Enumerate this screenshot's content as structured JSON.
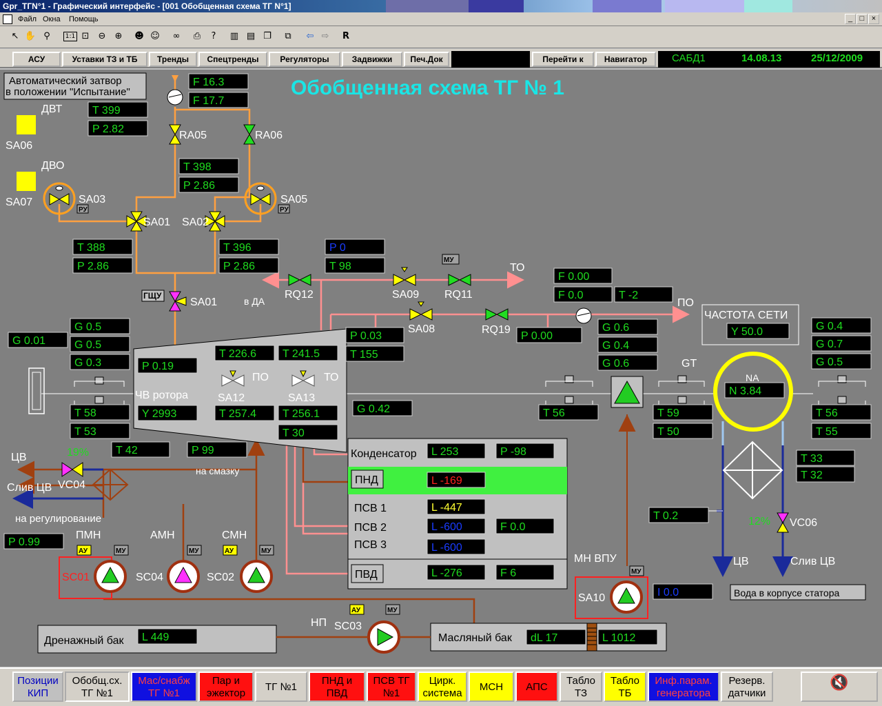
{
  "window": {
    "title": "Gpr_TГN°1 - Графический интерфейс - [001 Обобщенная схема ТГ N°1]",
    "menu": [
      "Файл",
      "Окна",
      "Помощь"
    ],
    "controls": [
      "_",
      "□",
      "×"
    ]
  },
  "toolbar": {
    "r_label": "R"
  },
  "nav": {
    "buttons": [
      "АСУ",
      "Уставки ТЗ и ТБ",
      "Тренды",
      "Спецтренды",
      "Регуляторы",
      "Задвижки",
      "Печ.Док"
    ],
    "goto": "Перейти к",
    "navigator": "Навигатор",
    "sabd": "САБД1",
    "time": "14.08.13",
    "date": "25/12/2009"
  },
  "scheme": {
    "title": "Обобщенная схема ТГ  № 1",
    "shutter_notice_line1": "Автоматический затвор",
    "shutter_notice_line2": "в положении \"Испытание\"",
    "dvt": "ДВТ",
    "dvo": "ДВО",
    "sa06": "SA06",
    "sa07": "SA07",
    "valves": {
      "ra05": "RA05",
      "ra06": "RA06",
      "sa03": "SA03",
      "sa05": "SA05",
      "sa01": "SA01",
      "sa02": "SA02",
      "sa01b": "SA01",
      "rq12": "RQ12",
      "sa09": "SA09",
      "rq11": "RQ11",
      "sa08": "SA08",
      "rq19": "RQ19",
      "sa12": "SA12",
      "sa13": "SA13",
      "vc04": "VC04",
      "vc06": "VC06"
    },
    "tags": {
      "ru": "РУ",
      "gshu": "ГЩУ",
      "mu": "МУ",
      "au": "АУ"
    },
    "labels": {
      "to": "ТО",
      "po": "ПО",
      "v_da": "в ДА",
      "po_small": "ПО",
      "to_small": "ТО",
      "chv_rotora": "ЧВ ротора",
      "gt": "GT",
      "na": "NA",
      "cv": "ЦВ",
      "sliv_cv": "Слив ЦВ",
      "na_regulirovanie": "на регулирование",
      "na_smazku": "на смазку",
      "pmn": "ПМН",
      "amn": "АМН",
      "smn": "СМН",
      "sc01": "SC01",
      "sc04": "SC04",
      "sc02": "SC02",
      "np": "НП",
      "sc03": "SC03",
      "mn_vpu": "МН ВПУ",
      "sa10": "SA10",
      "cv2": "ЦВ",
      "sliv_cv2": "Слив ЦВ",
      "voda": "Вода в корпусе статора",
      "drain": "Дренажный бак",
      "oil": "Масляный бак",
      "chastota": "ЧАСТОТА СЕТИ",
      "vc04_pct": "19%",
      "vc06_pct": "12%"
    },
    "readings": {
      "f1": "F  16.3",
      "f2": "F  17.7",
      "t399": "T  399",
      "p282": "P  2.82",
      "t398": "T  398",
      "p286a": "P  2.86",
      "t388": "T  388",
      "p286b": "P  2.86",
      "t396": "T  396",
      "p286c": "P  2.86",
      "p0": "P  0",
      "t98": "T  98",
      "f000": "F  0.00",
      "f00": "F  0.0",
      "tm2": "T  -2",
      "p003": "P  0.03",
      "t155": "T  155",
      "p000": "P  0.00",
      "g001": "G  0.01",
      "g05a": "G  0.5",
      "g05b": "G  0.5",
      "g03": "G  0.3",
      "p019": "P  0.19",
      "y2993": "Y  2993",
      "t2266": "T  226.6",
      "t2415": "T  241.5",
      "t2574": "T  257.4",
      "t2561": "T  256.1",
      "t30": "T  30",
      "t58": "T  58",
      "t53": "T  53",
      "g042": "G  0.42",
      "t56a": "T  56",
      "g06a": "G  0.6",
      "g04a": "G  0.4",
      "g06b": "G  0.6",
      "t59": "T  59",
      "t50": "T  50",
      "y500": "Y  50.0",
      "n384": "N  3.84",
      "g04b": "G  0.4",
      "g07": "G  0.7",
      "g05c": "G  0.5",
      "t56b": "T  56",
      "t55": "T  55",
      "t33": "T  33",
      "t32": "T  32",
      "t02": "T  0.2",
      "t42": "T  42",
      "p99": "P  99",
      "p099": "P  0.99",
      "l449": "L  449",
      "dl17": "dL  17",
      "l1012": "L  1012",
      "i00": "I  0.0"
    },
    "condenser": {
      "kondensator": "Конденсатор",
      "l253": "L  253",
      "pm98": "P  -98",
      "pnd": "ПНД",
      "lm169": "L  -169",
      "psv1": "ПСВ 1",
      "lm447": "L  -447",
      "psv2": "ПСВ 2",
      "lm600a": "L  -600",
      "f00": "F  0.0",
      "psv3": "ПСВ 3",
      "lm600b": "L  -600",
      "pvd": "ПВД",
      "lm276": "L  -276",
      "f6": "F  6"
    }
  },
  "bottom": {
    "b1": "Позиции КИП",
    "b2": "Обобщ.сх. ТГ №1",
    "b3": "Мас/снабж ТГ №1",
    "b4": "Пар и эжектор",
    "b5": "ТГ №1",
    "b6": "ПНД и ПВД",
    "b7": "ПСВ ТГ №1",
    "b8": "Цирк. система",
    "b9": "МСН",
    "b10": "АПС",
    "b11": "Табло ТЗ",
    "b12": "Табло ТБ",
    "b13": "Инф.парам. генератора",
    "b14": "Резерв. датчики"
  },
  "colors": {
    "value_green": "#1fdc1f",
    "value_blue": "#1a3cff",
    "value_red": "#ff2020",
    "value_yellow": "#ffff30",
    "title_cyan": "#19e6e6",
    "orange_pipe": "#ffa040",
    "pink_pipe": "#ff9090",
    "brown_pipe": "#a04010"
  }
}
